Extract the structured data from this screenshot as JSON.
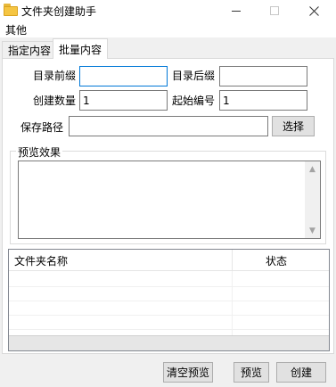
{
  "window": {
    "title": "文件夹创建助手",
    "icon": "folder-icon"
  },
  "menu": {
    "items": [
      "其他"
    ]
  },
  "tabs": [
    {
      "label": "指定内容",
      "active": false
    },
    {
      "label": "批量内容",
      "active": true
    }
  ],
  "form": {
    "dir_prefix": {
      "label": "目录前缀",
      "value": ""
    },
    "dir_suffix": {
      "label": "目录后缀",
      "value": ""
    },
    "create_count": {
      "label": "创建数量",
      "value": "1"
    },
    "start_number": {
      "label": "起始编号",
      "value": "1"
    },
    "save_path": {
      "label": "保存路径",
      "value": ""
    },
    "select_button": "选择"
  },
  "preview": {
    "legend": "预览效果",
    "text": ""
  },
  "list": {
    "columns": [
      "文件夹名称",
      "状态"
    ],
    "rows": []
  },
  "actions": {
    "clear_preview": "清空预览",
    "preview": "预览",
    "create": "创建"
  },
  "colors": {
    "accent": "#0078d7",
    "window_bg": "#f0f0f0",
    "folder": "#f5c542"
  }
}
